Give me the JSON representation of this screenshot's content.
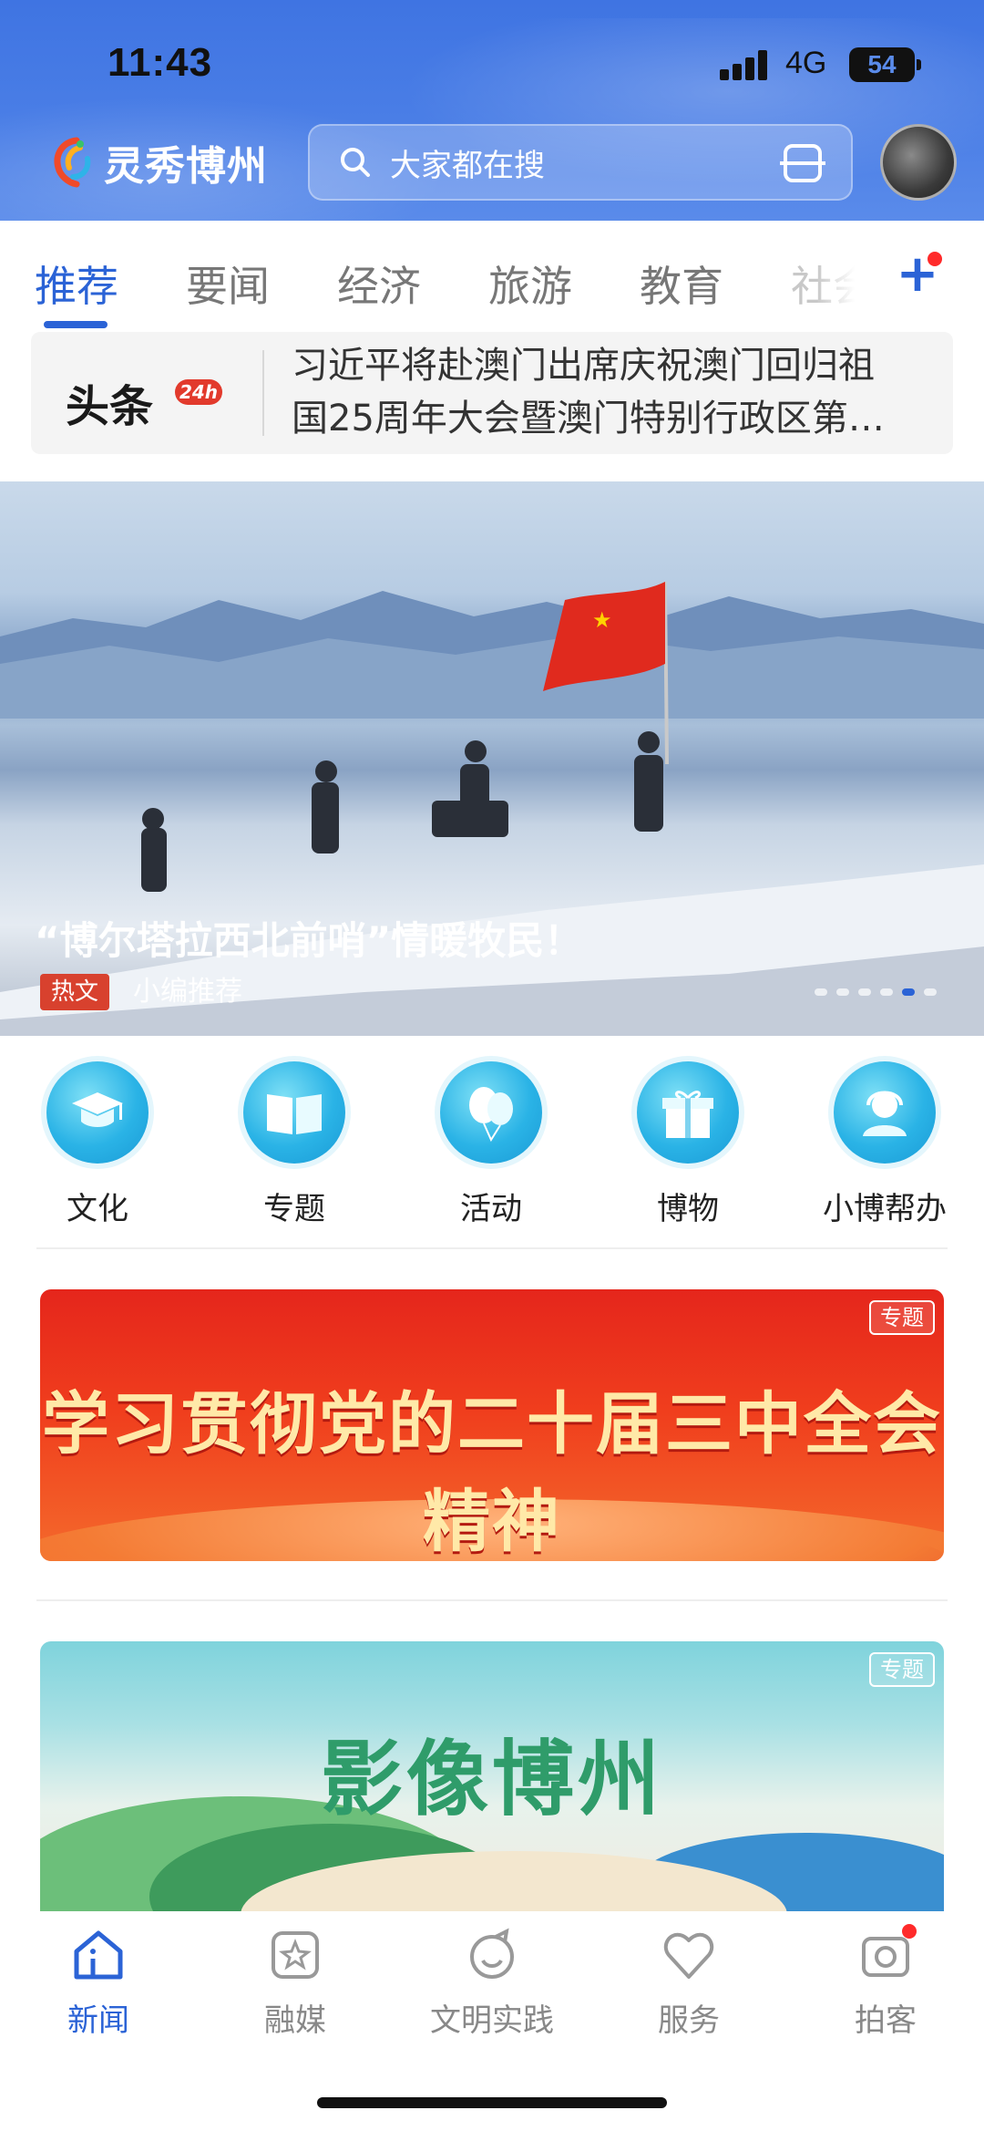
{
  "status_bar": {
    "time": "11:43",
    "network": "4G",
    "battery": "54"
  },
  "header": {
    "app_name": "灵秀博州",
    "search_placeholder": "大家都在搜"
  },
  "tabs": {
    "items": [
      "推荐",
      "要闻",
      "经济",
      "旅游",
      "教育"
    ],
    "overflow_label": "社会",
    "active": "推荐"
  },
  "headline": {
    "badge_text": "头条",
    "badge_tag": "24h",
    "line1": "习近平将赴澳门出席庆祝澳门回归祖",
    "line2": "国25周年大会暨澳门特别行政区第…"
  },
  "banner": {
    "caption": "“博尔塔拉西北前哨”情暖牧民！",
    "hot_label": "热文",
    "source": "小编推荐",
    "slide_count": 6,
    "active_slide": 5
  },
  "entries": [
    {
      "label": "文化",
      "icon": "graduation-cap-icon"
    },
    {
      "label": "专题",
      "icon": "book-icon"
    },
    {
      "label": "活动",
      "icon": "balloon-icon"
    },
    {
      "label": "博物",
      "icon": "gift-icon"
    },
    {
      "label": "小博帮办",
      "icon": "customer-service-icon"
    }
  ],
  "promos": [
    {
      "title": "学习贯彻党的二十届三中全会精神",
      "tag": "专题"
    },
    {
      "title": "影像博州",
      "tag": "专题"
    }
  ],
  "bottom_nav": [
    {
      "label": "新闻",
      "icon": "home-icon",
      "active": true
    },
    {
      "label": "融媒",
      "icon": "media-icon",
      "active": false
    },
    {
      "label": "文明实践",
      "icon": "practice-icon",
      "active": false
    },
    {
      "label": "服务",
      "icon": "heart-service-icon",
      "active": false
    },
    {
      "label": "拍客",
      "icon": "camera-icon",
      "active": false
    }
  ],
  "colors": {
    "header_blue": "#4a7ee6",
    "accent_blue": "#2b63d6",
    "notification_red": "#ff2a2a",
    "promo_red": "#e5261c"
  }
}
